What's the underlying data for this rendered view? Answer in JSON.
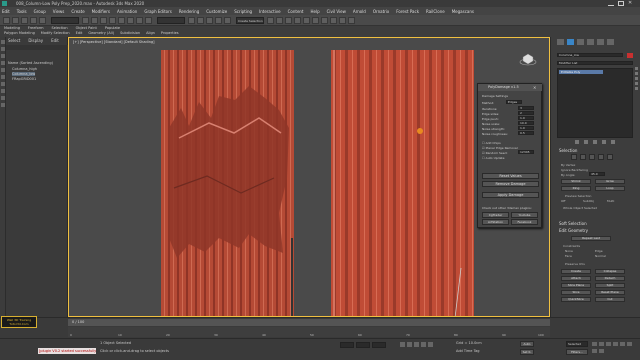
{
  "window": {
    "title": "008_Column-Low Poly Prep_2020.max - Autodesk 3ds Max 2020"
  },
  "menu": [
    "Edit",
    "Tools",
    "Group",
    "Views",
    "Create",
    "Modifiers",
    "Animation",
    "Graph Editors",
    "Rendering",
    "Customize",
    "Scripting",
    "Interactive",
    "Content",
    "Help",
    "Civil View",
    "Arnold",
    "Ornatrix",
    "Forest Pack",
    "RailClone",
    "Megascans"
  ],
  "toolbar": {
    "selection_set": "Create Selection Se"
  },
  "ribbon": {
    "tabs": [
      "Modeling",
      "Freeform",
      "Selection",
      "Object Paint",
      "Populate"
    ],
    "sub": [
      "Polygon Modeling",
      "Modify Selection",
      "Edit",
      "Geometry (All)",
      "Subdivision",
      "Align",
      "Properties"
    ]
  },
  "explorer": {
    "tabs": [
      "Select",
      "Display",
      "Edit"
    ],
    "rows": [
      "Name (Sorted Ascending)",
      "Columna_high",
      "Columna_low",
      "FRapGRiD001"
    ]
  },
  "viewport": {
    "label": "[+] [Perspective] [Standard] [Default Shading]"
  },
  "cmdpanel": {
    "object_name": "Columna_low",
    "modifier_list": "Modifier List",
    "stack_item": "Editable Poly",
    "selection_head": "Selection",
    "by_vertex": "By Vertex",
    "ignore_backfacing": "Ignore Backfacing",
    "by_angle": "By Angle:",
    "angle_val": "45.0",
    "shrink": "Shrink",
    "grow": "Grow",
    "ring": "Ring",
    "loop": "Loop",
    "preview_selection": "Preview Selection",
    "off": "Off",
    "subobj": "SubObj",
    "multi": "Multi",
    "whole_selected": "Whole Object Selected",
    "soft_selection": "Soft Selection",
    "edit_geometry": "Edit Geometry",
    "repeat_last": "Repeat Last",
    "constraints": "Constraints",
    "none": "None",
    "edge": "Edge",
    "face": "Face",
    "normal": "Normal",
    "preserve_uvs": "Preserve UVs",
    "create": "Create",
    "collapse": "Collapse",
    "attach": "Attach",
    "detach": "Detach",
    "slice_plane": "Slice Plane",
    "split": "Split",
    "slice": "Slice",
    "reset_plane": "Reset Plane",
    "quickslice": "QuickSlice",
    "cut": "Cut"
  },
  "dialog": {
    "title": "PolyDamage v1.5",
    "damage_settings": "Damage Settings",
    "method_label": "Method:",
    "method_val": "Edges",
    "params": [
      {
        "label": "Iterations:",
        "value": "3"
      },
      {
        "label": "Edge sides:",
        "value": "2"
      },
      {
        "label": "Edge push:",
        "value": "1.0"
      },
      {
        "label": "Noise scale:",
        "value": "10.0"
      },
      {
        "label": "Noise strength:",
        "value": "1.0"
      },
      {
        "label": "Noise roughness:",
        "value": "0.5"
      }
    ],
    "checks": [
      "Add Chips",
      "Planar Edge Removal",
      "Random Seed:",
      "Auto Update"
    ],
    "seed_val": "12345",
    "reset_values": "Reset Values",
    "remove_damage": "Remove Damage",
    "apply_damage": "Apply Damage",
    "check_out": "Check out other 3dsmax plugins:",
    "links": [
      "CgTrader",
      "Youtube",
      "ArtStation",
      "Facebook"
    ]
  },
  "timeline": {
    "frame": "0 / 100",
    "ticks": [
      "0",
      "10",
      "20",
      "30",
      "40",
      "50",
      "60",
      "70",
      "80",
      "90",
      "100"
    ]
  },
  "status": {
    "maxscript": "[plugin V0.2 started successfully]",
    "selected": "1 Object Selected",
    "prompt": "Click or click-and-drag to select objects",
    "grid": "Grid = 10.0cm",
    "add_time_tag": "Add Time Tag",
    "auto": "Auto",
    "selected_label": "Selected",
    "set_key": "Set K.",
    "filters": "Filters..."
  },
  "watermark": {
    "line1": "Wall 3D Training",
    "line2": "Tutor3d.Com"
  }
}
